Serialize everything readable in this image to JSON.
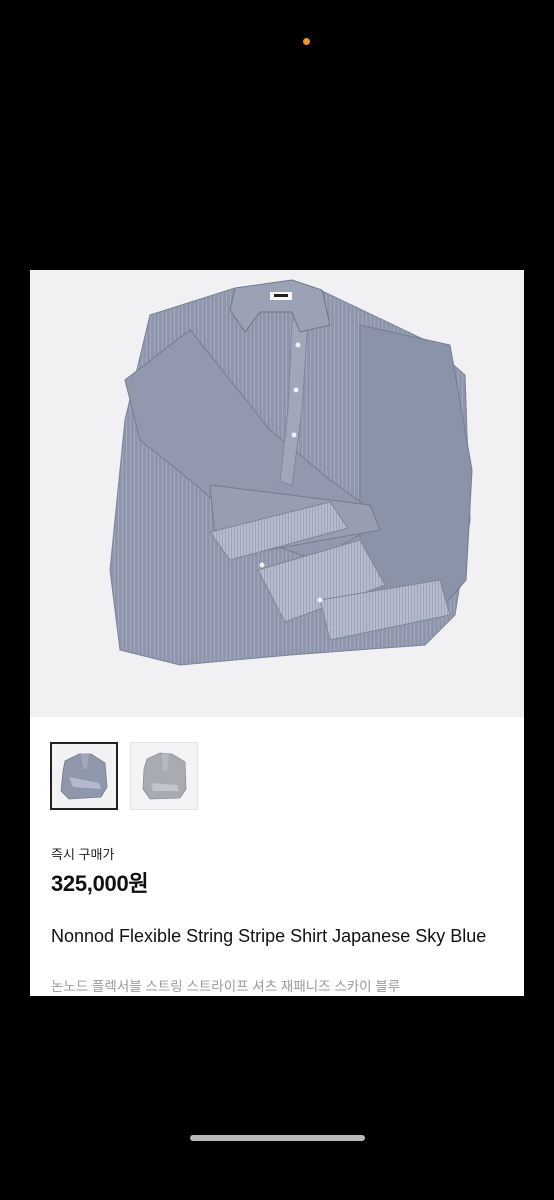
{
  "status": {
    "indicator_color": "#f5922a",
    "indicator_icon": "privacy-indicator-dot"
  },
  "product": {
    "images": [
      {
        "name": "shirt-photo-front",
        "selected": true
      },
      {
        "name": "shirt-photo-detail",
        "selected": false
      }
    ],
    "price_label": "즉시 구매가",
    "price": "325,000원",
    "title": "Nonnod Flexible String Stripe Shirt Japanese Sky Blue",
    "subtitle": "논노드 플렉서블 스트링 스트라이프 셔츠 재패니즈 스카이 블루"
  },
  "colors": {
    "background": "#000000",
    "card": "#ffffff",
    "shirt": "#8f97ad"
  }
}
